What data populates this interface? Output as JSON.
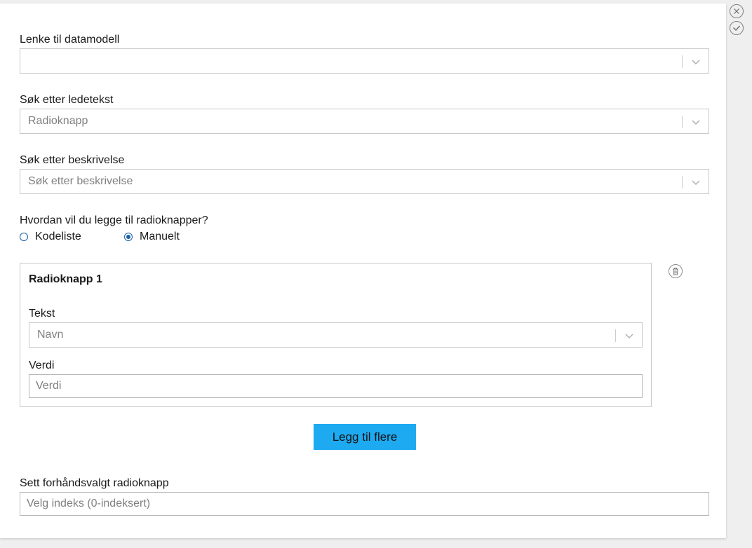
{
  "form": {
    "datamodel": {
      "label": "Lenke til datamodell",
      "value": ""
    },
    "ledetekst": {
      "label": "Søk etter ledetekst",
      "value": "Radioknapp"
    },
    "beskrivelse": {
      "label": "Søk etter beskrivelse",
      "placeholder": "Søk etter beskrivelse"
    },
    "mode": {
      "question": "Hvordan vil du legge til radioknapper?",
      "options": [
        {
          "label": "Kodeliste",
          "checked": false
        },
        {
          "label": "Manuelt",
          "checked": true
        }
      ]
    },
    "radio_items": [
      {
        "title": "Radioknapp 1",
        "text_label": "Tekst",
        "text_value": "Navn",
        "value_label": "Verdi",
        "value_placeholder": "Verdi"
      }
    ],
    "add_more_label": "Legg til flere",
    "preselected": {
      "label": "Sett forhåndsvalgt radioknapp",
      "placeholder": "Velg indeks (0-indeksert)"
    }
  },
  "side_actions": {
    "icons": [
      "close-icon",
      "check-icon"
    ]
  },
  "colors": {
    "accent": "#1eaaf1",
    "radio": "#1b5fa8",
    "border": "#c8c8c8",
    "background": "#efefef"
  }
}
